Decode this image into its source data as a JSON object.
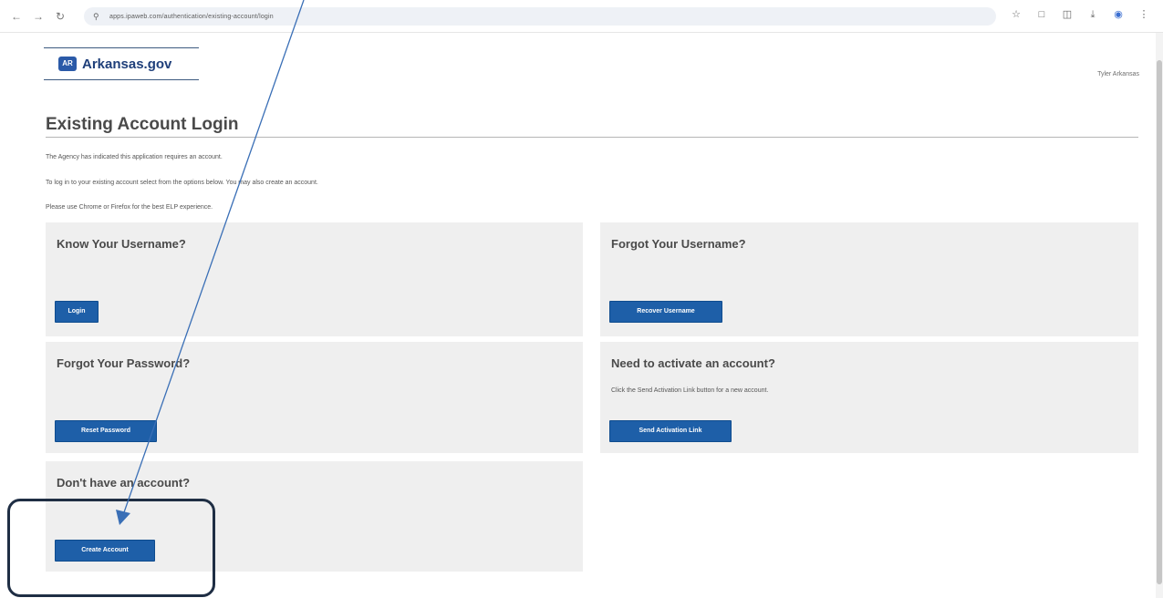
{
  "browser": {
    "url": "apps.ipaweb.com/authentication/existing-account/login",
    "icons": [
      "back-icon",
      "forward-icon",
      "reload-icon",
      "site-info-icon",
      "bookmark-star-icon",
      "extension-icon",
      "split-view-icon",
      "download-icon",
      "profile-icon",
      "menu-icon"
    ]
  },
  "header": {
    "logo_text": "Arkansas.gov",
    "user_name": "Tyler Arkansas"
  },
  "page": {
    "title": "Existing Account Login",
    "intro": [
      "The Agency has indicated this application requires an account.",
      "To log in to your existing account select from the options below. You may also create an account.",
      "Please use Chrome or Firefox for the best ELP experience."
    ]
  },
  "panels": {
    "know_username": {
      "title": "Know Your Username?",
      "button": "Login"
    },
    "forgot_username": {
      "title": "Forgot Your Username?",
      "button": "Recover Username"
    },
    "forgot_password": {
      "title": "Forgot Your Password?",
      "button": "Reset Password"
    },
    "activate": {
      "title": "Need to activate an account?",
      "description": "Click the Send Activation Link button for a new account.",
      "button": "Send Activation Link"
    },
    "create": {
      "title": "Don't have an account?",
      "button": "Create Account"
    }
  },
  "colors": {
    "button_blue": "#1e5fa8",
    "panel_gray": "#efefef",
    "annotation_dark": "#1f2e44",
    "arrow_blue": "#3a6fb6"
  }
}
